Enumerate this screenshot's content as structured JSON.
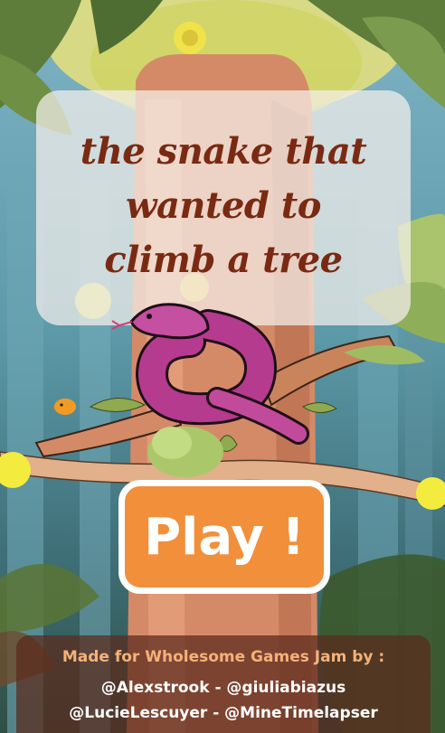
{
  "game": {
    "title": "the snake that\nwanted to\nclimb a tree",
    "play_label": "Play !",
    "credits": {
      "heading": "Made for Wholesome Games Jam by :",
      "line1": "@Alexstrook - @giuliabiazus",
      "line2": "@LucieLescuyer - @MineTimelapser"
    }
  },
  "colors": {
    "title": "#7a2a12",
    "play_button": "#f28f3b",
    "credits_heading": "#f4b27a",
    "snake": "#b53b8f"
  }
}
